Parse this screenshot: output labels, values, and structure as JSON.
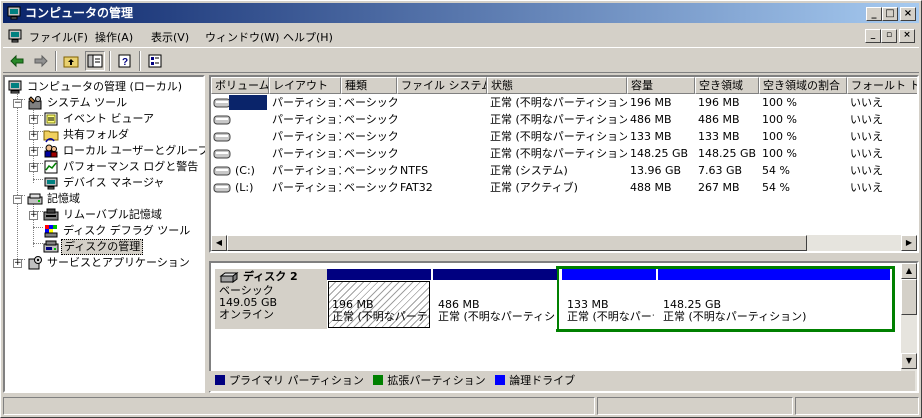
{
  "window": {
    "title": "コンピュータの管理",
    "minimize_glyph": "_",
    "maximize_glyph": "□",
    "close_glyph": "×"
  },
  "menu": {
    "items": [
      "ファイル(F)",
      "操作(A)",
      "表示(V)",
      "ウィンドウ(W)",
      "ヘルプ(H)"
    ],
    "mdi_minimize": "_",
    "mdi_restore": "▫",
    "mdi_close": "×"
  },
  "tree": {
    "root": "コンピュータの管理 (ローカル)",
    "system_tools": "システム ツール",
    "event_viewer": "イベント ビューア",
    "shared_folders": "共有フォルダ",
    "local_users": "ローカル ユーザーとグループ",
    "perf_logs": "パフォーマンス ログと警告",
    "device_manager": "デバイス マネージャ",
    "storage": "記憶域",
    "removable": "リムーバブル記憶域",
    "defrag": "ディスク デフラグ ツール",
    "disk_mgmt": "ディスクの管理",
    "services": "サービスとアプリケーション",
    "plus": "+",
    "minus": "−"
  },
  "volume_table": {
    "columns": [
      "ボリューム",
      "レイアウト",
      "種類",
      "ファイル システム",
      "状態",
      "容量",
      "空き領域",
      "空き領域の割合",
      "フォールト トレ"
    ],
    "rows": [
      {
        "volume": "",
        "layout": "パーティション",
        "type": "ベーシック",
        "fs": "",
        "status": "正常 (不明なパーティション)",
        "capacity": "196 MB",
        "free": "196 MB",
        "pct": "100 %",
        "fault": "いいえ"
      },
      {
        "volume": "",
        "layout": "パーティション",
        "type": "ベーシック",
        "fs": "",
        "status": "正常 (不明なパーティション)",
        "capacity": "486 MB",
        "free": "486 MB",
        "pct": "100 %",
        "fault": "いいえ"
      },
      {
        "volume": "",
        "layout": "パーティション",
        "type": "ベーシック",
        "fs": "",
        "status": "正常 (不明なパーティション)",
        "capacity": "133 MB",
        "free": "133 MB",
        "pct": "100 %",
        "fault": "いいえ"
      },
      {
        "volume": "",
        "layout": "パーティション",
        "type": "ベーシック",
        "fs": "",
        "status": "正常 (不明なパーティション)",
        "capacity": "148.25 GB",
        "free": "148.25 GB",
        "pct": "100 %",
        "fault": "いいえ"
      },
      {
        "volume": "(C:)",
        "layout": "パーティション",
        "type": "ベーシック",
        "fs": "NTFS",
        "status": "正常 (システム)",
        "capacity": "13.96 GB",
        "free": "7.63 GB",
        "pct": "54 %",
        "fault": "いいえ"
      },
      {
        "volume": "(L:)",
        "layout": "パーティション",
        "type": "ベーシック",
        "fs": "FAT32",
        "status": "正常 (アクティブ)",
        "capacity": "488 MB",
        "free": "267 MB",
        "pct": "54 %",
        "fault": "いいえ"
      }
    ]
  },
  "disk": {
    "name": "ディスク 2",
    "type": "ベーシック",
    "size": "149.05 GB",
    "state": "オンライン",
    "partitions": [
      {
        "size": "196 MB",
        "status": "正常 (不明なパーティション)",
        "kind": "primary"
      },
      {
        "size": "486 MB",
        "status": "正常 (不明なパーティション)",
        "kind": "primary"
      },
      {
        "size": "133 MB",
        "status": "正常 (不明なパーティション)",
        "kind": "logical"
      },
      {
        "size": "148.25 GB",
        "status": "正常 (不明なパーティション)",
        "kind": "logical"
      }
    ]
  },
  "legend": {
    "primary": "プライマリ パーティション",
    "extended": "拡張パーティション",
    "logical": "論理ドライブ"
  },
  "colors": {
    "title_start": "#0a246a",
    "title_end": "#a6caf0",
    "primary": "#000080",
    "extended": "#008000",
    "logical": "#0000ff",
    "face": "#d4d0c8"
  },
  "scroll": {
    "left": "◀",
    "right": "▶",
    "up": "▲",
    "down": "▼"
  }
}
